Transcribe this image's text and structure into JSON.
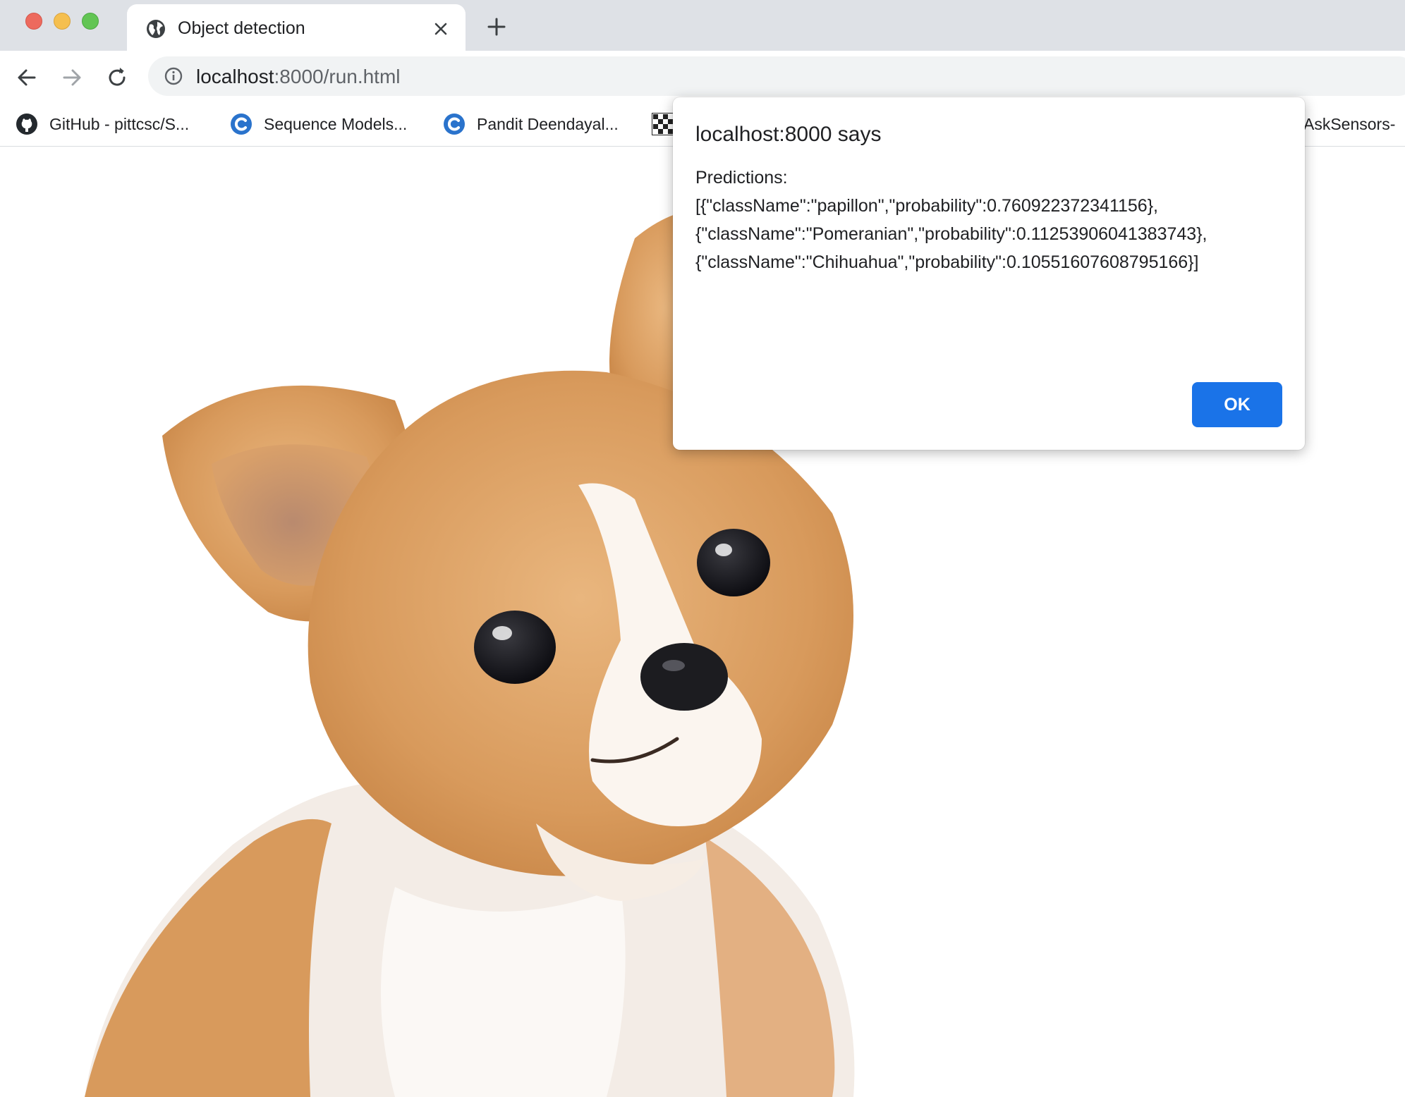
{
  "window": {
    "tab_title": "Object detection",
    "new_tab_symbol": "+"
  },
  "toolbar": {
    "url_host": "localhost",
    "url_rest": ":8000/run.html"
  },
  "bookmarks": [
    {
      "label": "GitHub - pittcsc/S...",
      "icon": "github-icon"
    },
    {
      "label": "Sequence Models...",
      "icon": "coursera-icon"
    },
    {
      "label": "Pandit Deendayal...",
      "icon": "coursera-icon"
    },
    {
      "label": "AskSensors-",
      "icon": ""
    }
  ],
  "dialog": {
    "title": "localhost:8000 says",
    "lines": [
      "Predictions:",
      "[{\"className\":\"papillon\",\"probability\":0.760922372341156},",
      "{\"className\":\"Pomeranian\",\"probability\":0.11253906041383743},",
      "{\"className\":\"Chihuahua\",\"probability\":0.10551607608795166}]"
    ],
    "ok_label": "OK"
  },
  "colors": {
    "accent": "#1a73e8",
    "tabstrip": "#dee1e6",
    "omnibox": "#f1f3f4"
  },
  "content": {
    "image_subject": "chihuahua-photo"
  }
}
